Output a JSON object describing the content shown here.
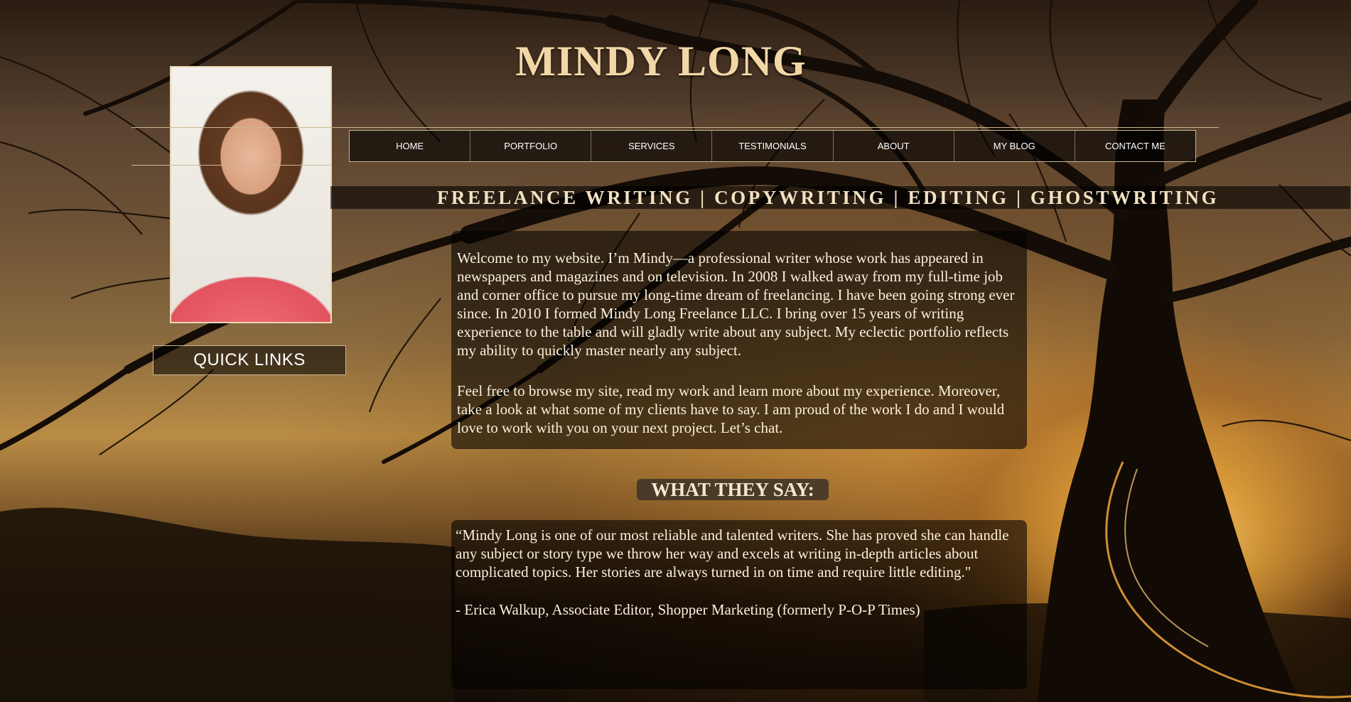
{
  "header": {
    "site_title": "MINDY LONG",
    "tagline": "FREELANCE WRITING | COPYWRITING | EDITING | GHOSTWRITING"
  },
  "sidebar": {
    "quick_links_label": "QUICK LINKS"
  },
  "nav": {
    "items": [
      {
        "label": "HOME"
      },
      {
        "label": "PORTFOLIO"
      },
      {
        "label": "SERVICES"
      },
      {
        "label": "TESTIMONIALS"
      },
      {
        "label": "ABOUT"
      },
      {
        "label": "MY BLOG"
      },
      {
        "label": "CONTACT ME"
      }
    ]
  },
  "intro": {
    "paragraph_1": "Welcome to my website. I’m Mindy—a professional writer whose work has appeared in newspapers and magazines and on television. In 2008 I walked away from my full-time job and corner office to pursue my long-time dream of freelancing. I have been going strong ever since. In 2010 I formed Mindy Long Freelance LLC. I bring over 15 years of writing experience to the table and will gladly write about any subject. My eclectic portfolio reflects my ability to quickly master nearly any subject.",
    "paragraph_2": "Feel free to browse my site, read my work and learn more about my experience. Moreover, take a look at what some of my clients have to say. I am proud of the work I do and I would love to work with you on your next project. Let’s chat."
  },
  "testimonials": {
    "heading": "WHAT THEY SAY:",
    "quote": "“Mindy Long is one of our most reliable and talented writers. She has proved she can handle any subject or story type we throw her way and excels at writing in-depth articles about complicated topics. Her stories are always turned in on time and require little editing.\"",
    "attribution": "- Erica Walkup, Associate Editor, Shopper Marketing (formerly P-O-P Times)"
  },
  "colors": {
    "title": "#f2d7a6",
    "panel_text": "#fbf0dc",
    "border_accent": "#c9b890"
  }
}
